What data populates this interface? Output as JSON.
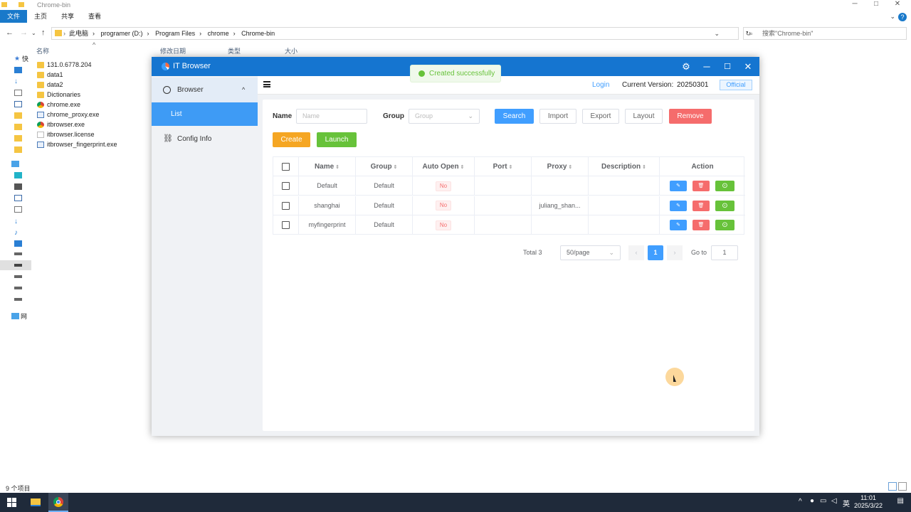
{
  "explorer": {
    "window_title": "Chrome-bin",
    "ribbon_tabs": [
      "文件",
      "主页",
      "共享",
      "查看"
    ],
    "path": [
      "此电脑",
      "programer (D:)",
      "Program Files",
      "chrome",
      "Chrome-bin"
    ],
    "search_placeholder": "搜索\"Chrome-bin\"",
    "columns": [
      "名称",
      "修改日期",
      "类型",
      "大小"
    ],
    "files": [
      {
        "name": "131.0.6778.204",
        "icon": "folder-icon"
      },
      {
        "name": "data1",
        "icon": "folder-icon"
      },
      {
        "name": "data2",
        "icon": "folder-icon"
      },
      {
        "name": "Dictionaries",
        "icon": "folder-icon"
      },
      {
        "name": "chrome.exe",
        "icon": "chrome-icon"
      },
      {
        "name": "chrome_proxy.exe",
        "icon": "exe-icon"
      },
      {
        "name": "itbrowser.exe",
        "icon": "chrome-icon"
      },
      {
        "name": "itbrowser.license",
        "icon": "file-icon"
      },
      {
        "name": "itbrowser_fingerprint.exe",
        "icon": "exe-icon"
      }
    ],
    "status": "9 个项目",
    "nav_labels": [
      "快",
      "网"
    ]
  },
  "taskbar": {
    "time": "11:01",
    "date": "2025/3/22",
    "ime": "英"
  },
  "app": {
    "title": "IT Browser",
    "sidebar": {
      "browser": "Browser",
      "list": "List",
      "config": "Config Info"
    },
    "topbar": {
      "login": "Login",
      "version_label": "Current Version:",
      "version": "20250301",
      "official": "Official"
    },
    "filters": {
      "name_label": "Name",
      "name_placeholder": "Name",
      "group_label": "Group",
      "group_placeholder": "Group"
    },
    "buttons": {
      "search": "Search",
      "import": "Import",
      "export": "Export",
      "layout": "Layout",
      "remove": "Remove",
      "create": "Create",
      "launch": "Launch"
    },
    "table": {
      "headers": [
        "Name",
        "Group",
        "Auto Open",
        "Port",
        "Proxy",
        "Description",
        "Action"
      ],
      "rows": [
        {
          "name": "Default",
          "group": "Default",
          "auto_open": "No",
          "port": "",
          "proxy": "",
          "description": ""
        },
        {
          "name": "shanghai",
          "group": "Default",
          "auto_open": "No",
          "port": "",
          "proxy": "juliang_shan...",
          "description": ""
        },
        {
          "name": "myfingerprint",
          "group": "Default",
          "auto_open": "No",
          "port": "",
          "proxy": "",
          "description": ""
        }
      ]
    },
    "pagination": {
      "total": "Total 3",
      "page_size": "50/page",
      "current_page": "1",
      "goto_label": "Go to",
      "goto_value": "1"
    },
    "toast": "Created successfully",
    "colors": {
      "header": "#1575d0",
      "primary": "#409eff",
      "danger": "#f56c6c",
      "warning": "#f5a623",
      "success": "#67c23a"
    }
  }
}
